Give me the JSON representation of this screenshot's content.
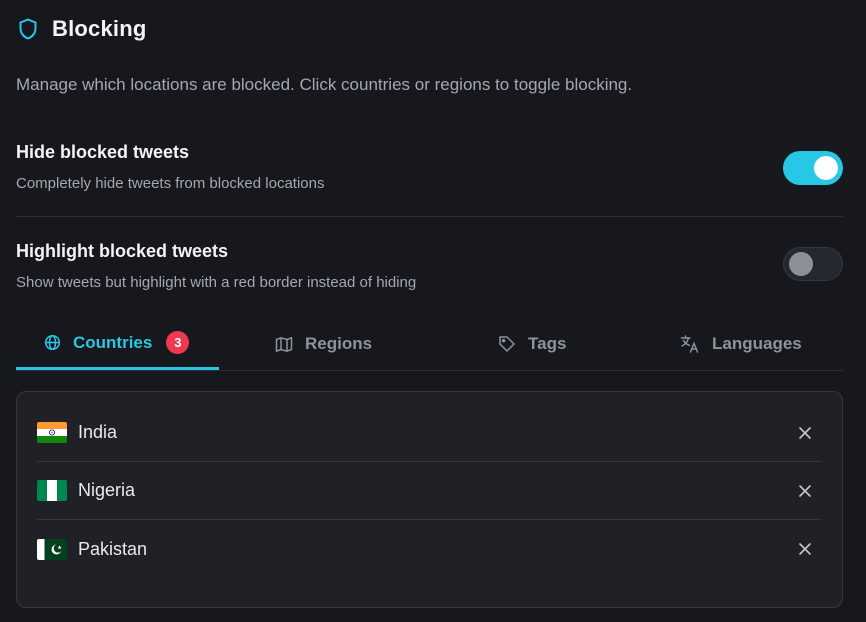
{
  "header": {
    "title": "Blocking",
    "icon": "shield-icon"
  },
  "description": "Manage which locations are blocked. Click countries or regions to toggle blocking.",
  "settings": [
    {
      "title": "Hide blocked tweets",
      "subtitle": "Completely hide tweets from blocked locations",
      "enabled": true
    },
    {
      "title": "Highlight blocked tweets",
      "subtitle": "Show tweets but highlight with a red border instead of hiding",
      "enabled": false
    }
  ],
  "tabs": [
    {
      "label": "Countries",
      "icon": "globe-icon",
      "badge": "3",
      "active": true
    },
    {
      "label": "Regions",
      "icon": "map-icon",
      "active": false
    },
    {
      "label": "Tags",
      "icon": "tag-icon",
      "active": false
    },
    {
      "label": "Languages",
      "icon": "translate-icon",
      "active": false
    }
  ],
  "blocked_countries": [
    {
      "name": "India",
      "flag": "india-flag-icon"
    },
    {
      "name": "Nigeria",
      "flag": "nigeria-flag-icon"
    },
    {
      "name": "Pakistan",
      "flag": "pakistan-flag-icon"
    }
  ],
  "colors": {
    "accent": "#29c7e6",
    "background": "#16181d",
    "badge": "#f0384f"
  }
}
